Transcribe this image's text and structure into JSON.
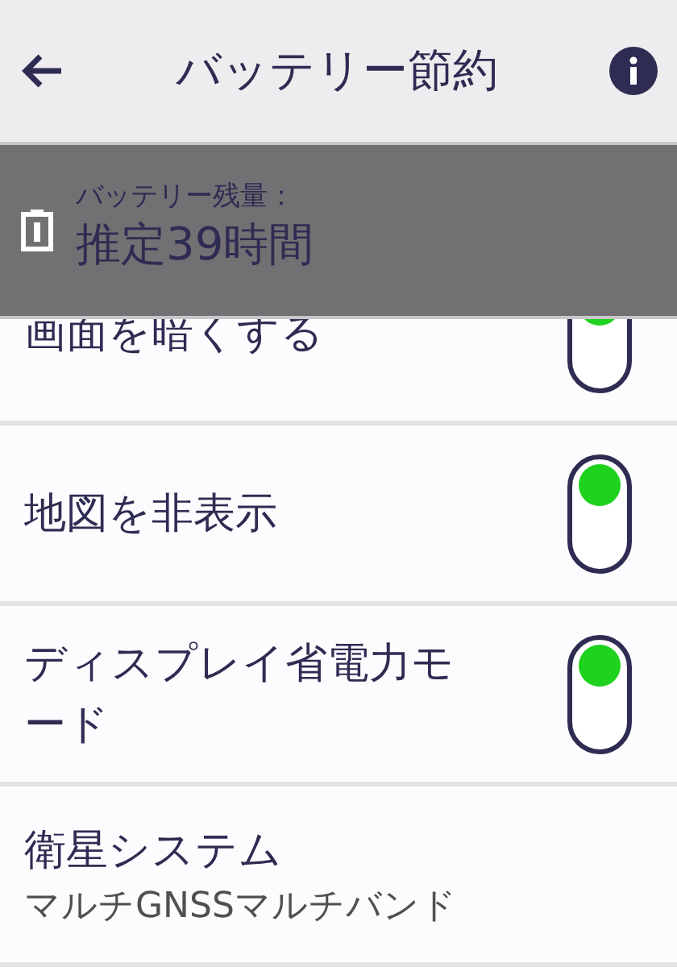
{
  "header": {
    "title": "バッテリー節約"
  },
  "banner": {
    "label": "バッテリー残量：",
    "value": "推定39時間"
  },
  "settings": [
    {
      "kind": "toggle",
      "label": "画面を暗くする",
      "on": true
    },
    {
      "kind": "toggle",
      "label": "地図を非表示",
      "on": true
    },
    {
      "kind": "toggle",
      "label": "ディスプレイ省電力モード",
      "on": true
    },
    {
      "kind": "value",
      "label": "衛星システム",
      "value": "マルチGNSSマルチバンド"
    }
  ]
}
